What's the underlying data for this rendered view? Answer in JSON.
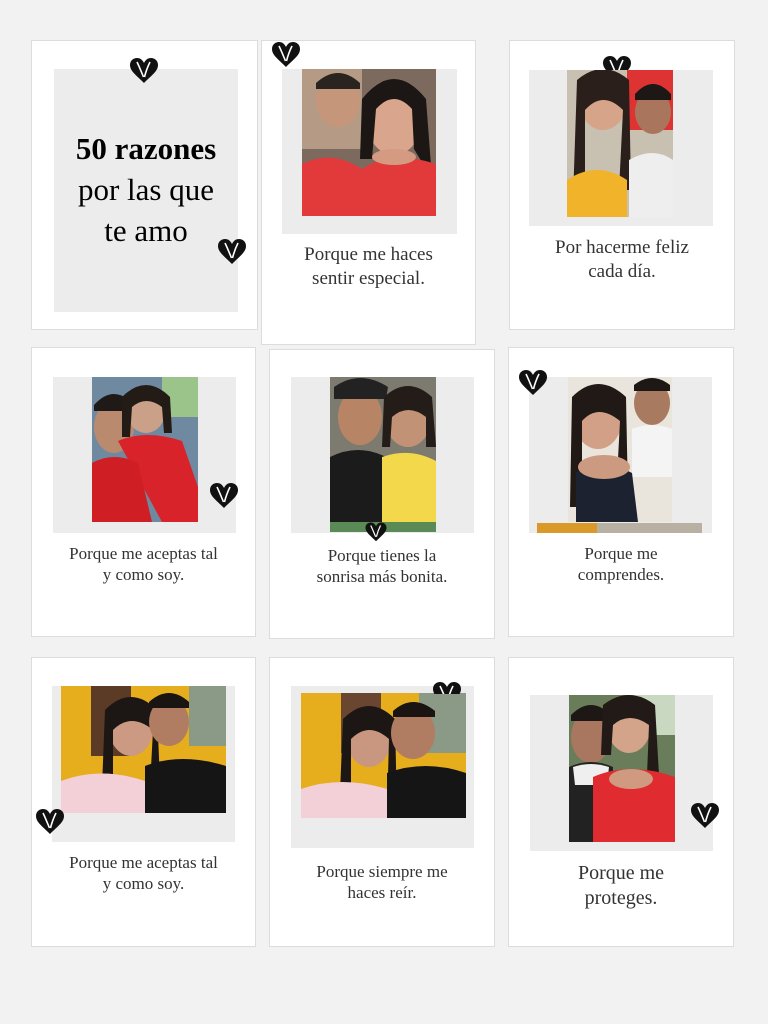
{
  "title": {
    "line1_number": "50",
    "line1_word": "razones",
    "line2": "por las que",
    "line3": "te amo"
  },
  "cards": [
    {
      "caption_line1": "Porque me haces",
      "caption_line2": "sentir especial."
    },
    {
      "caption_line1": "Por hacerme feliz",
      "caption_line2": "cada día."
    },
    {
      "caption_line1": "Porque me aceptas tal",
      "caption_line2": "y como soy."
    },
    {
      "caption_line1": "Porque tienes la",
      "caption_line2": "sonrisa más bonita."
    },
    {
      "caption_line1": "Porque me",
      "caption_line2": "comprendes."
    },
    {
      "caption_line1": "Porque me aceptas tal",
      "caption_line2": "y como soy."
    },
    {
      "caption_line1": "Porque siempre me",
      "caption_line2": "haces reír."
    },
    {
      "caption_line1": "Porque me",
      "caption_line2": "proteges."
    }
  ],
  "icons": {
    "decoration": "heart-icon"
  },
  "colors": {
    "background": "#f2f2f2",
    "card": "#ffffff",
    "frame": "#ececec",
    "heart": "#111111"
  }
}
